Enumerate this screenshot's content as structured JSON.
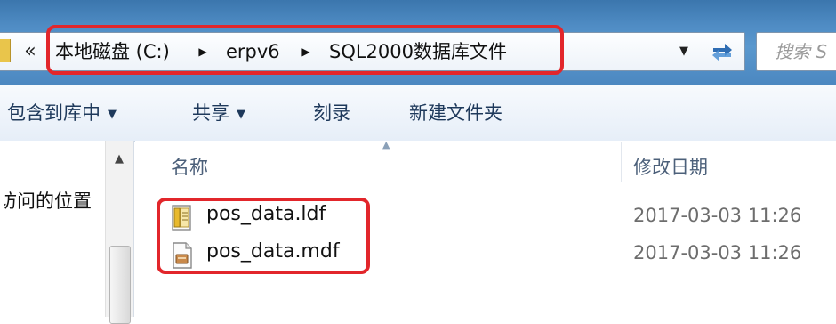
{
  "address_bar": {
    "overflow": "«",
    "breadcrumb": [
      "本地磁盘 (C:)",
      "erpv6",
      "SQL2000数据库文件"
    ],
    "dropdown_icon": "chevron-down-icon",
    "refresh_icon": "refresh-icon"
  },
  "search": {
    "placeholder": "搜索 S"
  },
  "toolbar": {
    "items": [
      {
        "label": "包含到库中",
        "has_menu": true
      },
      {
        "label": "共享",
        "has_menu": true
      },
      {
        "label": "刻录",
        "has_menu": false
      },
      {
        "label": "新建文件夹",
        "has_menu": false
      }
    ]
  },
  "nav": {
    "visible_text": "访问的位置"
  },
  "columns": {
    "name": "名称",
    "date": "修改日期"
  },
  "files": [
    {
      "name": "pos_data.ldf",
      "modified": "2017-03-03 11:26",
      "icon": "ldf-file-icon"
    },
    {
      "name": "pos_data.mdf",
      "modified": "2017-03-03 11:26",
      "icon": "mdf-file-icon"
    }
  ],
  "colors": {
    "highlight_box": "#e2262b",
    "titlebar": "#4f8cc4"
  }
}
